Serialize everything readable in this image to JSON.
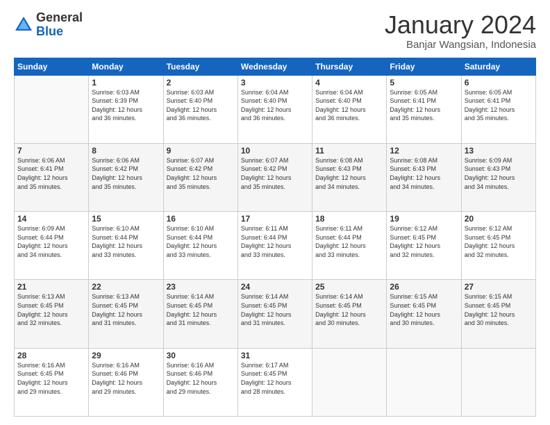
{
  "logo": {
    "general": "General",
    "blue": "Blue"
  },
  "title": "January 2024",
  "subtitle": "Banjar Wangsian, Indonesia",
  "weekdays": [
    "Sunday",
    "Monday",
    "Tuesday",
    "Wednesday",
    "Thursday",
    "Friday",
    "Saturday"
  ],
  "weeks": [
    [
      {
        "day": "",
        "info": ""
      },
      {
        "day": "1",
        "info": "Sunrise: 6:03 AM\nSunset: 6:39 PM\nDaylight: 12 hours\nand 36 minutes."
      },
      {
        "day": "2",
        "info": "Sunrise: 6:03 AM\nSunset: 6:40 PM\nDaylight: 12 hours\nand 36 minutes."
      },
      {
        "day": "3",
        "info": "Sunrise: 6:04 AM\nSunset: 6:40 PM\nDaylight: 12 hours\nand 36 minutes."
      },
      {
        "day": "4",
        "info": "Sunrise: 6:04 AM\nSunset: 6:40 PM\nDaylight: 12 hours\nand 36 minutes."
      },
      {
        "day": "5",
        "info": "Sunrise: 6:05 AM\nSunset: 6:41 PM\nDaylight: 12 hours\nand 35 minutes."
      },
      {
        "day": "6",
        "info": "Sunrise: 6:05 AM\nSunset: 6:41 PM\nDaylight: 12 hours\nand 35 minutes."
      }
    ],
    [
      {
        "day": "7",
        "info": "Sunrise: 6:06 AM\nSunset: 6:41 PM\nDaylight: 12 hours\nand 35 minutes."
      },
      {
        "day": "8",
        "info": "Sunrise: 6:06 AM\nSunset: 6:42 PM\nDaylight: 12 hours\nand 35 minutes."
      },
      {
        "day": "9",
        "info": "Sunrise: 6:07 AM\nSunset: 6:42 PM\nDaylight: 12 hours\nand 35 minutes."
      },
      {
        "day": "10",
        "info": "Sunrise: 6:07 AM\nSunset: 6:42 PM\nDaylight: 12 hours\nand 35 minutes."
      },
      {
        "day": "11",
        "info": "Sunrise: 6:08 AM\nSunset: 6:43 PM\nDaylight: 12 hours\nand 34 minutes."
      },
      {
        "day": "12",
        "info": "Sunrise: 6:08 AM\nSunset: 6:43 PM\nDaylight: 12 hours\nand 34 minutes."
      },
      {
        "day": "13",
        "info": "Sunrise: 6:09 AM\nSunset: 6:43 PM\nDaylight: 12 hours\nand 34 minutes."
      }
    ],
    [
      {
        "day": "14",
        "info": "Sunrise: 6:09 AM\nSunset: 6:44 PM\nDaylight: 12 hours\nand 34 minutes."
      },
      {
        "day": "15",
        "info": "Sunrise: 6:10 AM\nSunset: 6:44 PM\nDaylight: 12 hours\nand 33 minutes."
      },
      {
        "day": "16",
        "info": "Sunrise: 6:10 AM\nSunset: 6:44 PM\nDaylight: 12 hours\nand 33 minutes."
      },
      {
        "day": "17",
        "info": "Sunrise: 6:11 AM\nSunset: 6:44 PM\nDaylight: 12 hours\nand 33 minutes."
      },
      {
        "day": "18",
        "info": "Sunrise: 6:11 AM\nSunset: 6:44 PM\nDaylight: 12 hours\nand 33 minutes."
      },
      {
        "day": "19",
        "info": "Sunrise: 6:12 AM\nSunset: 6:45 PM\nDaylight: 12 hours\nand 32 minutes."
      },
      {
        "day": "20",
        "info": "Sunrise: 6:12 AM\nSunset: 6:45 PM\nDaylight: 12 hours\nand 32 minutes."
      }
    ],
    [
      {
        "day": "21",
        "info": "Sunrise: 6:13 AM\nSunset: 6:45 PM\nDaylight: 12 hours\nand 32 minutes."
      },
      {
        "day": "22",
        "info": "Sunrise: 6:13 AM\nSunset: 6:45 PM\nDaylight: 12 hours\nand 31 minutes."
      },
      {
        "day": "23",
        "info": "Sunrise: 6:14 AM\nSunset: 6:45 PM\nDaylight: 12 hours\nand 31 minutes."
      },
      {
        "day": "24",
        "info": "Sunrise: 6:14 AM\nSunset: 6:45 PM\nDaylight: 12 hours\nand 31 minutes."
      },
      {
        "day": "25",
        "info": "Sunrise: 6:14 AM\nSunset: 6:45 PM\nDaylight: 12 hours\nand 30 minutes."
      },
      {
        "day": "26",
        "info": "Sunrise: 6:15 AM\nSunset: 6:45 PM\nDaylight: 12 hours\nand 30 minutes."
      },
      {
        "day": "27",
        "info": "Sunrise: 6:15 AM\nSunset: 6:45 PM\nDaylight: 12 hours\nand 30 minutes."
      }
    ],
    [
      {
        "day": "28",
        "info": "Sunrise: 6:16 AM\nSunset: 6:45 PM\nDaylight: 12 hours\nand 29 minutes."
      },
      {
        "day": "29",
        "info": "Sunrise: 6:16 AM\nSunset: 6:46 PM\nDaylight: 12 hours\nand 29 minutes."
      },
      {
        "day": "30",
        "info": "Sunrise: 6:16 AM\nSunset: 6:46 PM\nDaylight: 12 hours\nand 29 minutes."
      },
      {
        "day": "31",
        "info": "Sunrise: 6:17 AM\nSunset: 6:45 PM\nDaylight: 12 hours\nand 28 minutes."
      },
      {
        "day": "",
        "info": ""
      },
      {
        "day": "",
        "info": ""
      },
      {
        "day": "",
        "info": ""
      }
    ]
  ]
}
